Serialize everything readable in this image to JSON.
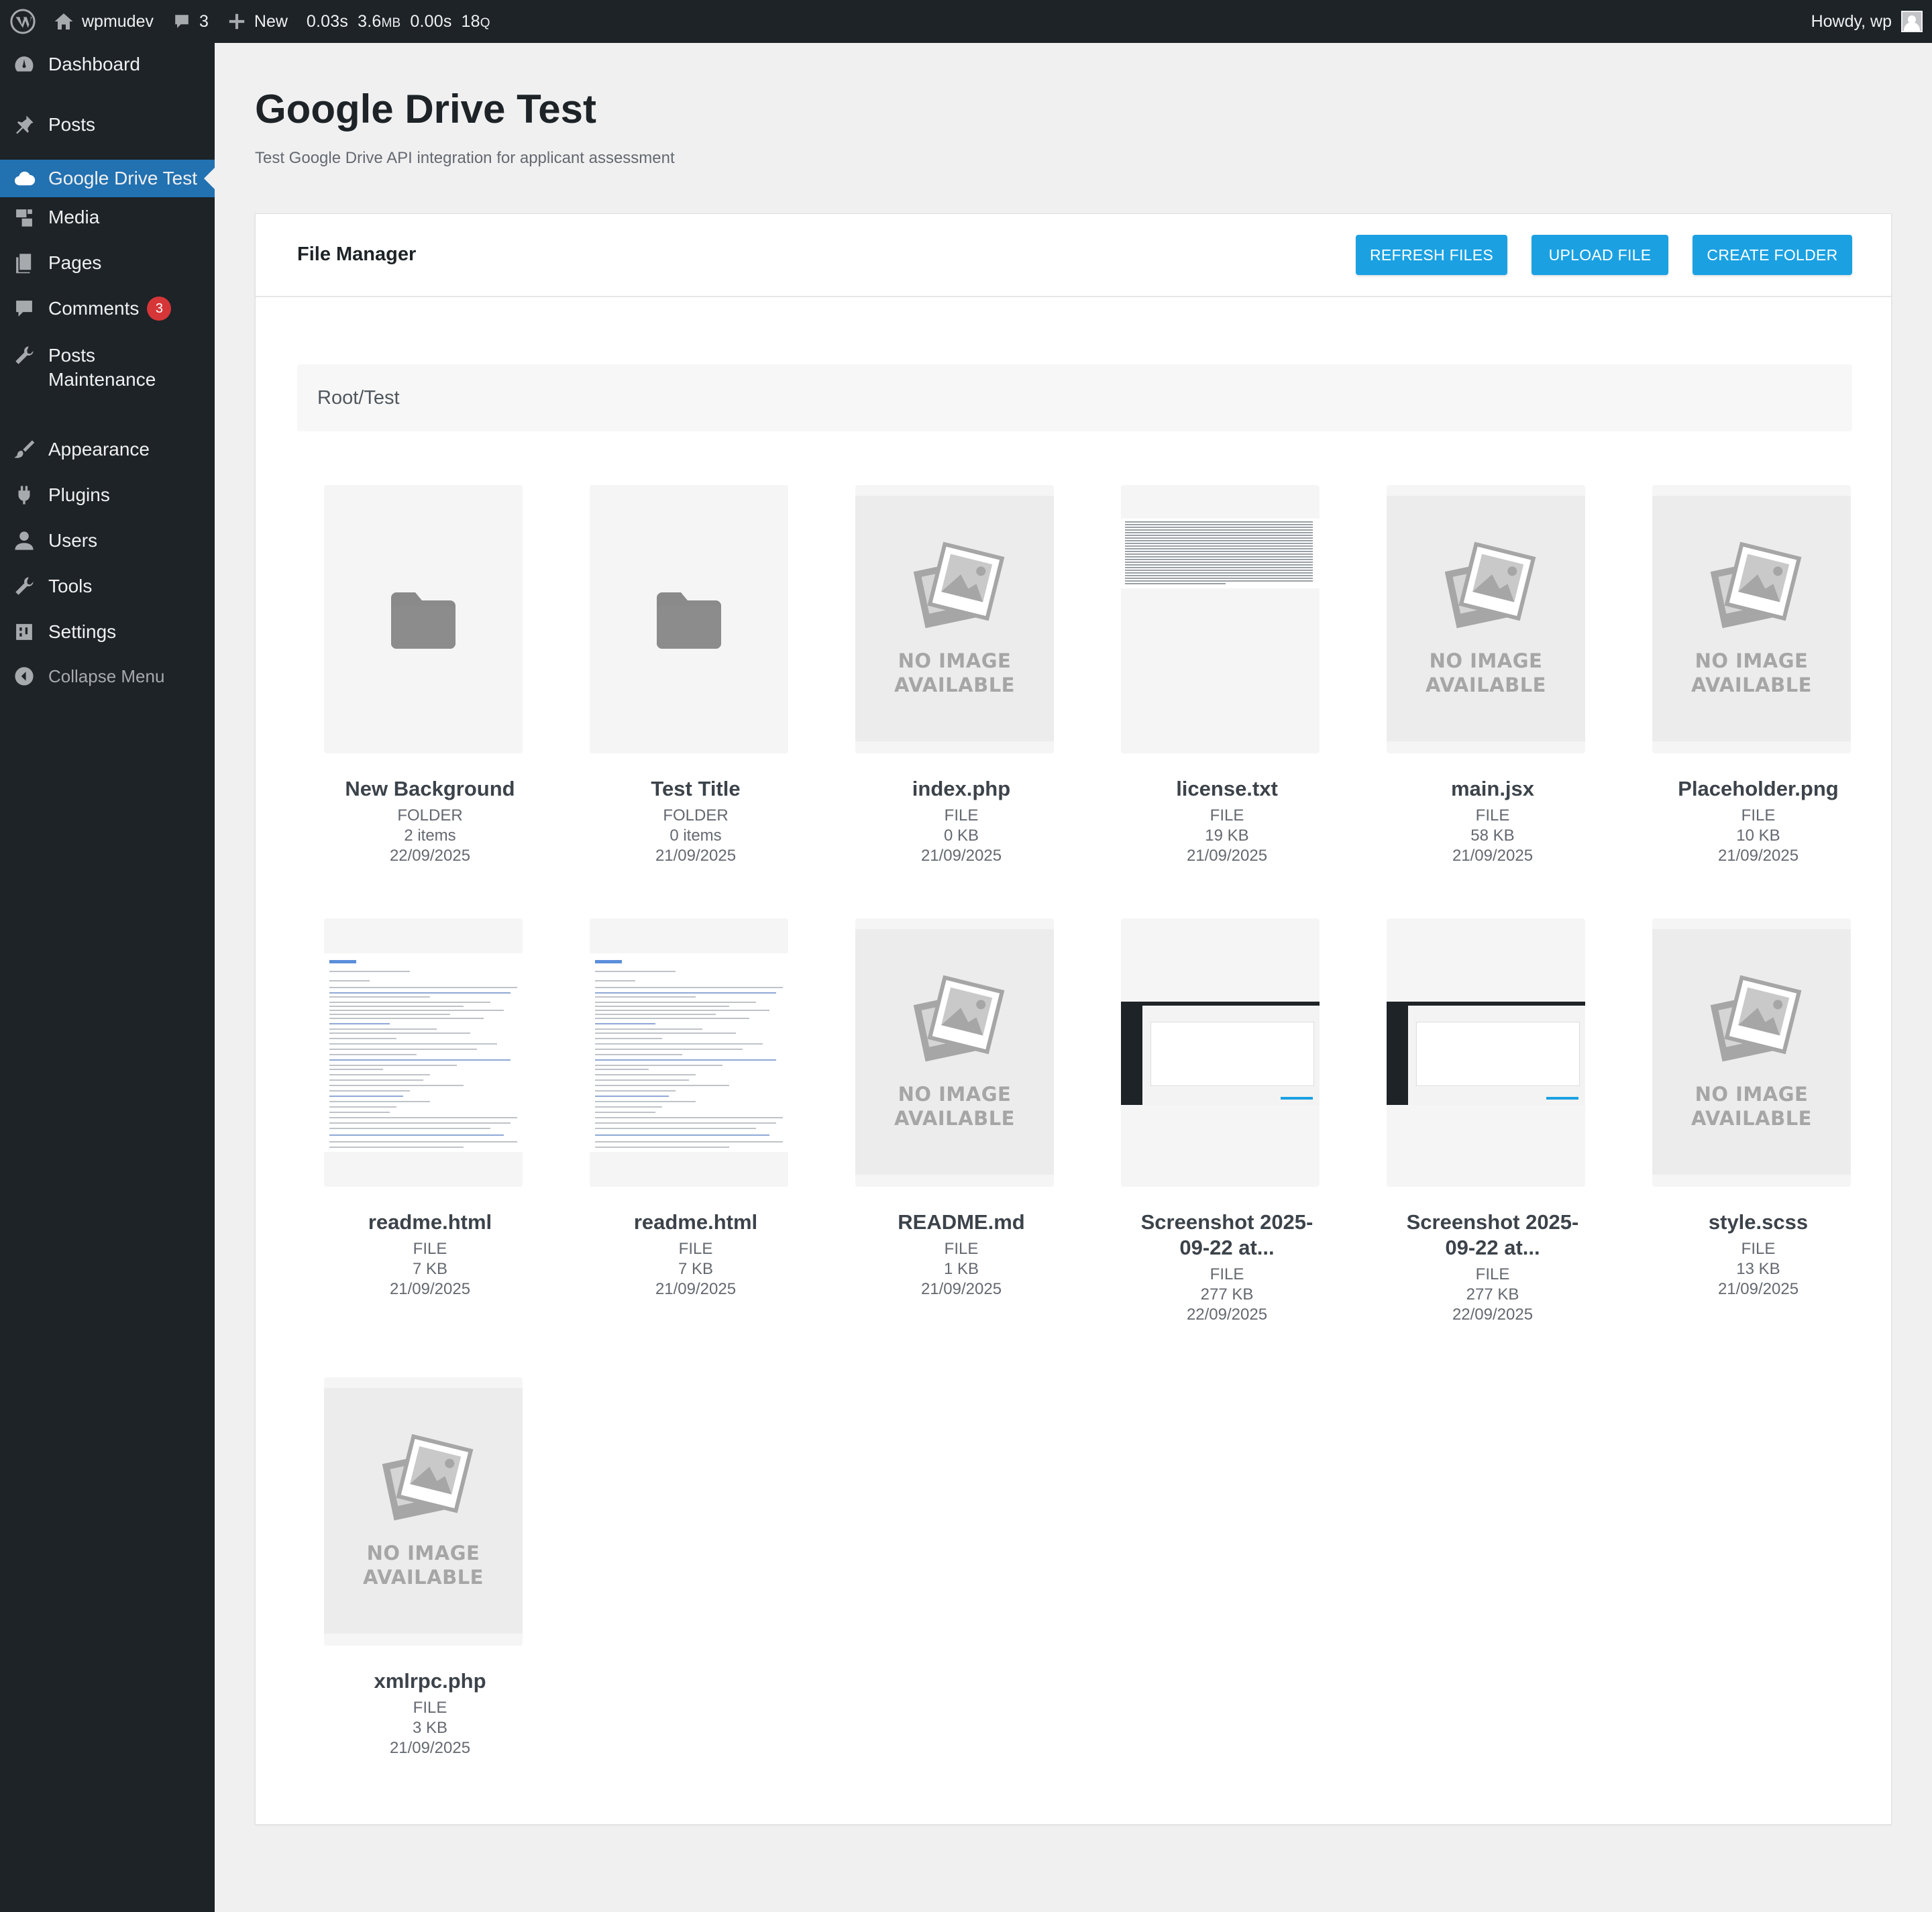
{
  "adminbar": {
    "site_name": "wpmudev",
    "comments_count": "3",
    "new_label": "New",
    "stats": {
      "time": "0.03s",
      "memory_value": "3.6",
      "memory_unit": "MB",
      "db_time": "0.00s",
      "queries_value": "18",
      "queries_unit": "Q"
    },
    "howdy": "Howdy, wp"
  },
  "sidebar": {
    "items": [
      {
        "label": "Dashboard",
        "icon": "dashboard-icon"
      },
      {
        "label": "Posts",
        "icon": "pin-icon"
      },
      {
        "label": "Google Drive Test",
        "icon": "cloud-icon",
        "current": true
      },
      {
        "label": "Media",
        "icon": "media-icon"
      },
      {
        "label": "Pages",
        "icon": "pages-icon"
      },
      {
        "label": "Comments",
        "icon": "comment-icon",
        "badge": "3"
      },
      {
        "label": "Posts Maintenance",
        "label_line1": "Posts",
        "label_line2": "Maintenance",
        "icon": "wrench-icon"
      },
      {
        "label": "Appearance",
        "icon": "brush-icon"
      },
      {
        "label": "Plugins",
        "icon": "plugin-icon"
      },
      {
        "label": "Users",
        "icon": "user-icon"
      },
      {
        "label": "Tools",
        "icon": "wrench-icon"
      },
      {
        "label": "Settings",
        "icon": "settings-icon"
      },
      {
        "label": "Collapse Menu",
        "icon": "collapse-icon"
      }
    ]
  },
  "page": {
    "title": "Google Drive Test",
    "subtitle": "Test Google Drive API integration for applicant assessment"
  },
  "file_manager": {
    "title": "File Manager",
    "buttons": {
      "refresh": "REFRESH FILES",
      "upload": "UPLOAD FILE",
      "create": "CREATE FOLDER"
    },
    "breadcrumb": "Root/Test",
    "no_image_line1": "NO IMAGE",
    "no_image_line2": "AVAILABLE",
    "items": [
      {
        "name": "New Background",
        "type": "FOLDER",
        "size": "2 items",
        "date": "22/09/2025",
        "thumb": "folder"
      },
      {
        "name": "Test Title",
        "type": "FOLDER",
        "size": "0 items",
        "date": "21/09/2025",
        "thumb": "folder"
      },
      {
        "name": "index.php",
        "type": "FILE",
        "size": "0 KB",
        "date": "21/09/2025",
        "thumb": "noimage"
      },
      {
        "name": "license.txt",
        "type": "FILE",
        "size": "19 KB",
        "date": "21/09/2025",
        "thumb": "text"
      },
      {
        "name": "main.jsx",
        "type": "FILE",
        "size": "58 KB",
        "date": "21/09/2025",
        "thumb": "noimage"
      },
      {
        "name": "Placeholder.png",
        "type": "FILE",
        "size": "10 KB",
        "date": "21/09/2025",
        "thumb": "noimage"
      },
      {
        "name": "readme.html",
        "type": "FILE",
        "size": "7 KB",
        "date": "21/09/2025",
        "thumb": "document"
      },
      {
        "name": "readme.html",
        "type": "FILE",
        "size": "7 KB",
        "date": "21/09/2025",
        "thumb": "document"
      },
      {
        "name": "README.md",
        "type": "FILE",
        "size": "1 KB",
        "date": "21/09/2025",
        "thumb": "noimage"
      },
      {
        "name_line1": "Screenshot 2025-",
        "name_line2": "09-22 at...",
        "type": "FILE",
        "size": "277 KB",
        "date": "22/09/2025",
        "thumb": "screenshot"
      },
      {
        "name_line1": "Screenshot 2025-",
        "name_line2": "09-22 at...",
        "type": "FILE",
        "size": "277 KB",
        "date": "22/09/2025",
        "thumb": "screenshot"
      },
      {
        "name": "style.scss",
        "type": "FILE",
        "size": "13 KB",
        "date": "21/09/2025",
        "thumb": "noimage"
      },
      {
        "name": "xmlrpc.php",
        "type": "FILE",
        "size": "3 KB",
        "date": "21/09/2025",
        "thumb": "noimage"
      }
    ]
  },
  "colors": {
    "adminbar_bg": "#1d2327",
    "menu_current": "#2271b1",
    "button": "#1ba1e2",
    "badge": "#d63638"
  }
}
